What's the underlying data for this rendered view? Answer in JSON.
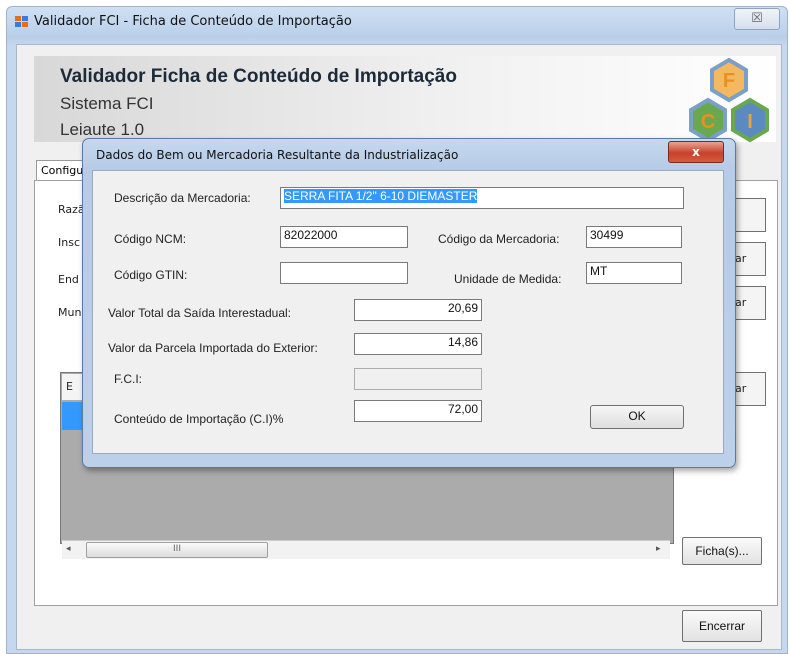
{
  "window": {
    "title": "Validador FCI - Ficha de Conteúdo de Importação",
    "close_glyph": "☒"
  },
  "header": {
    "title": "Validador Ficha de Conteúdo de Importação",
    "subtitle": "Sistema FCI",
    "layout": "Leiaute 1.0",
    "logo_letters": [
      "F",
      "C",
      "I"
    ]
  },
  "tabs": [
    "Configu"
  ],
  "background": {
    "field_labels": [
      "Razã",
      "Insc",
      "End",
      "Mun"
    ],
    "side_buttons": [
      "",
      "ar",
      "ar",
      "ar"
    ],
    "grid_header": "E",
    "scroll_thumb": "III",
    "scroll_left": "◂",
    "scroll_right": "▸",
    "fichas_button": "Ficha(s)...",
    "encerrar_button": "Encerrar"
  },
  "dialog": {
    "title": "Dados do Bem ou Mercadoria Resultante da Industrialização",
    "close_glyph": "x",
    "descricao_label": "Descrição da Mercadoria:",
    "descricao_value": "SERRA FITA 1/2\" 6-10 DIEMASTER",
    "ncm_label": "Código NCM:",
    "ncm_value": "82022000",
    "codigo_mercadoria_label": "Código da Mercadoria:",
    "codigo_mercadoria_value": "30499",
    "gtin_label": "Código GTIN:",
    "gtin_value": "",
    "unidade_label": "Unidade de Medida:",
    "unidade_value": "MT",
    "valor_total_label": "Valor Total da Saída Interestadual:",
    "valor_total_value": "20,69",
    "valor_parcela_label": "Valor da Parcela Importada do Exterior:",
    "valor_parcela_value": "14,86",
    "fci_label": "F.C.I:",
    "fci_value": "",
    "conteudo_label": "Conteúdo de Importação (C.I)%",
    "conteudo_value": "72,00",
    "ok_label": "OK"
  },
  "colors": {
    "selection": "#3399ff",
    "logo_orange": "#e8a040",
    "logo_green": "#6aa84f",
    "logo_blue": "#4a7ab8"
  }
}
